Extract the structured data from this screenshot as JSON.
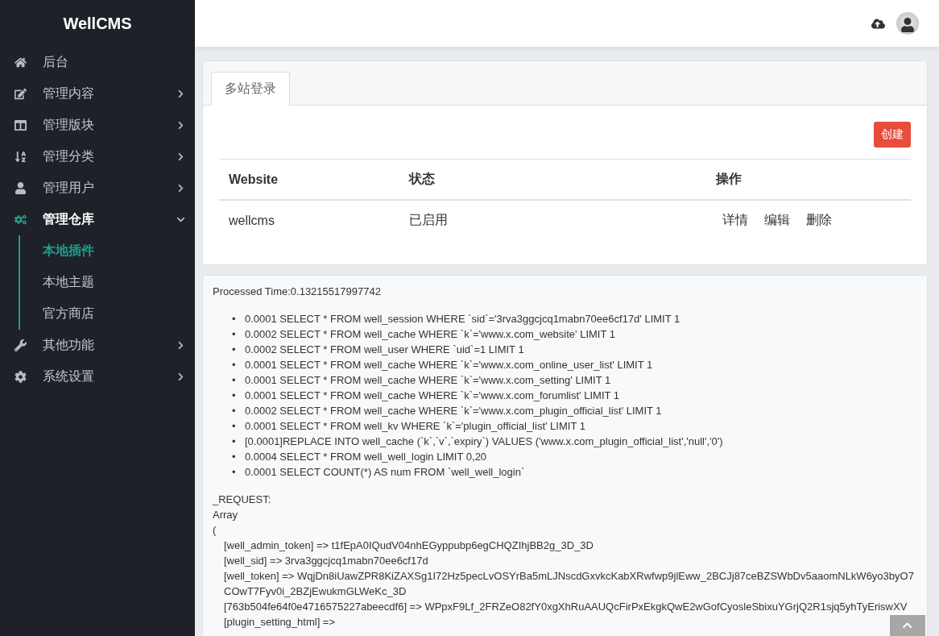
{
  "sidebar": {
    "brand": "WellCMS",
    "items": [
      {
        "kind": "home",
        "label": "后台",
        "selected": false
      },
      {
        "kind": "edit",
        "label": "管理内容",
        "selected": false,
        "expanded": false
      },
      {
        "kind": "columns",
        "label": "管理版块",
        "selected": false,
        "expanded": false
      },
      {
        "kind": "sort",
        "label": "管理分类",
        "selected": false,
        "expanded": false
      },
      {
        "kind": "user",
        "label": "管理用户",
        "selected": false,
        "expanded": false
      },
      {
        "kind": "cogs",
        "label": "管理仓库",
        "selected": true,
        "expanded": true,
        "children": [
          {
            "label": "本地插件",
            "selected": true
          },
          {
            "label": "本地主题",
            "selected": false
          },
          {
            "label": "官方商店",
            "selected": false
          }
        ]
      },
      {
        "kind": "wrench",
        "label": "其他功能",
        "selected": false,
        "expanded": false
      },
      {
        "kind": "gear",
        "label": "系统设置",
        "selected": false,
        "expanded": false
      }
    ]
  },
  "tabs": [
    {
      "label": "多站登录",
      "selected": true
    }
  ],
  "create_button": "创建",
  "table": {
    "columns": [
      "Website",
      "状态",
      "操作"
    ],
    "rows": [
      {
        "website": "wellcms",
        "status": "已启用",
        "actions": [
          "详情",
          "编辑",
          "删除"
        ]
      }
    ]
  },
  "debug": {
    "processed_time": "Processed Time:0.13215517997742",
    "queries": [
      {
        "bullet": "•",
        "text": "0.0001 SELECT * FROM well_session WHERE `sid`='3rva3ggcjcq1mabn70ee6cf17d' LIMIT 1"
      },
      {
        "bullet": "•",
        "text": "0.0002 SELECT * FROM well_cache WHERE `k`='www.x.com_website' LIMIT 1"
      },
      {
        "bullet": "•",
        "text": "0.0002 SELECT * FROM well_user WHERE `uid`=1 LIMIT 1"
      },
      {
        "bullet": "•",
        "text": "0.0001 SELECT * FROM well_cache WHERE `k`='www.x.com_online_user_list' LIMIT 1"
      },
      {
        "bullet": "•",
        "text": "0.0001 SELECT * FROM well_cache WHERE `k`='www.x.com_setting' LIMIT 1"
      },
      {
        "bullet": "•",
        "text": "0.0001 SELECT * FROM well_cache WHERE `k`='www.x.com_forumlist' LIMIT 1"
      },
      {
        "bullet": "•",
        "text": "0.0002 SELECT * FROM well_cache WHERE `k`='www.x.com_plugin_official_list' LIMIT 1"
      },
      {
        "bullet": "•",
        "text": "0.0001 SELECT * FROM well_kv WHERE `k`='plugin_official_list' LIMIT 1"
      },
      {
        "bullet": "•",
        "text": "[0.0001]REPLACE INTO well_cache (`k`,`v`,`expiry`) VALUES ('www.x.com_plugin_official_list','null','0')"
      },
      {
        "bullet": "•",
        "text": "0.0004 SELECT * FROM well_well_login LIMIT 0,20"
      },
      {
        "bullet": "•",
        "text": "0.0001 SELECT COUNT(*) AS num FROM `well_well_login`"
      }
    ],
    "dump": [
      {
        "kind": "plain",
        "text": "_REQUEST:"
      },
      {
        "kind": "plain",
        "text": "Array"
      },
      {
        "kind": "plain",
        "text": "("
      },
      {
        "kind": "entry",
        "text": "[well_admin_token] => t1fEpA0IQudV04nhEGyppubp6egCHQZIhjBB2g_3D_3D"
      },
      {
        "kind": "entry",
        "text": "[well_sid] => 3rva3ggcjcq1mabn70ee6cf17d"
      },
      {
        "kind": "entry",
        "text": "[well_token] => WqjDn8iUawZPR8KiZAXSg1I72Hz5pecLvOSYrBa5mLJNscdGxvkcKabXRwfwp9jlEww_2BCJj87ceBZSWbDv5aaomNLkW6yo3byO7COwT7Fyv0i_2BZjEwukmGLWeKc_3D"
      },
      {
        "kind": "entry",
        "text": "[763b504fe64f0e4716575227abeecdf6] => WPpxF9Lf_2FRZeO82fY0xgXhRuAAUQcFirPxEkgkQwE2wGofCyosleSbixuYGrjQ2R1sjq5yhTyEriswXV"
      },
      {
        "kind": "entry",
        "text": "[plugin_setting_html] =>"
      }
    ]
  }
}
